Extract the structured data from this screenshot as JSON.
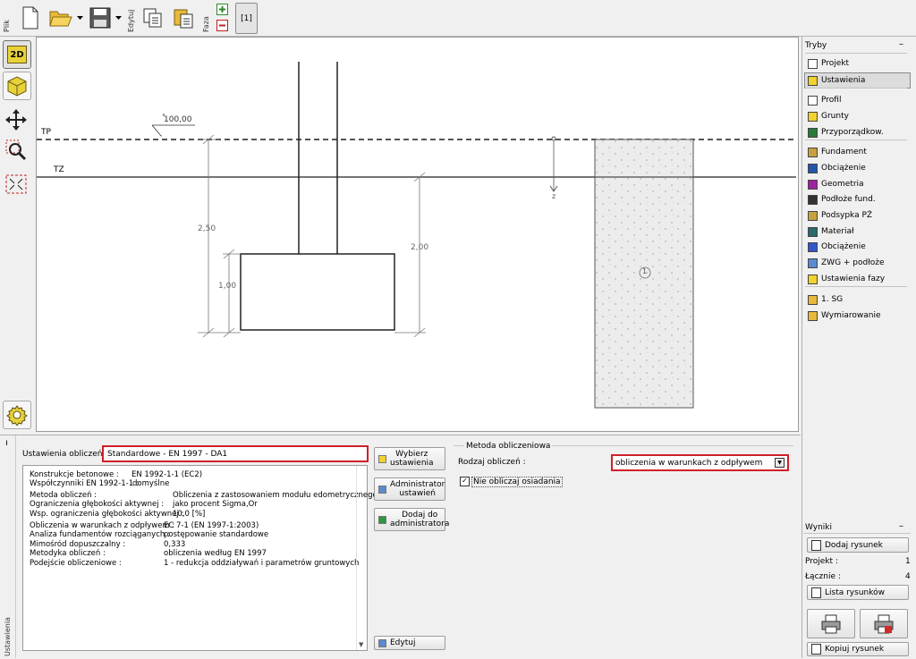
{
  "toolbar": {
    "file_group": "Plik",
    "edit_group": "Edytuj",
    "phase_group": "Faza",
    "phase_tab": "[1]"
  },
  "left_tools": {
    "btn_2d": "2D",
    "btn_3d": "3D"
  },
  "drawing": {
    "label_tp": "TP",
    "label_tz": "TZ",
    "dim_100": "100,00",
    "dim_250": "2,50",
    "dim_100b": "1,00",
    "dim_200": "2,00",
    "soil_number": "1",
    "axis_z": "z"
  },
  "right_panel": {
    "title": "Tryby",
    "items": [
      "Projekt",
      "Ustawienia",
      "Profil",
      "Grunty",
      "Przyporządkow.",
      "Fundament",
      "Obciążenie",
      "Geometria",
      "Podłoże fund.",
      "Podsypka PŻ",
      "Materiał",
      "Obciążenie",
      "ZWG + podłoże",
      "Ustawienia fazy",
      "1. SG",
      "Wymiarowanie"
    ],
    "results_title": "Wyniki",
    "add_drawing": "Dodaj rysunek",
    "project_label": "Projekt :",
    "project_value": "1",
    "total_label": "Łącznie :",
    "total_value": "4",
    "drawing_list": "Lista rysunków",
    "copy_drawing": "Kopiuj rysunek"
  },
  "bottom": {
    "side_tab": "Ustawienia",
    "settings_label": "Ustawienia obliczeń :",
    "settings_value": "Standardowe - EN 1997 - DA1",
    "info": [
      [
        "Konstrukcje betonowe :",
        "EN 1992-1-1 (EC2)"
      ],
      [
        "Współczynniki EN 1992-1-1 :",
        "domyślne"
      ],
      [
        "Metoda obliczeń :",
        "Obliczenia z zastosowaniem modułu edometrycznego"
      ],
      [
        "Ograniczenia głębokości aktywnej :",
        "jako procent Sigma,Or"
      ],
      [
        "Wsp. ograniczenia głębokości aktywnej :",
        "10,0 [%]"
      ],
      [
        "Obliczenia w warunkach z odpływem :",
        "EC 7-1 (EN 1997-1:2003)"
      ],
      [
        "Analiza fundamentów rozciąganych :",
        "postępowanie standardowe"
      ],
      [
        "Mimośród dopuszczalny :",
        "0,333"
      ],
      [
        "Metodyka obliczeń :",
        "obliczenia według EN 1997"
      ],
      [
        "Podejście obliczeniowe :",
        "1 - redukcja oddziaływań i parametrów gruntowych"
      ]
    ],
    "btn_select": [
      "Wybierz",
      "ustawienia"
    ],
    "btn_admin": [
      "Administrator",
      "ustawień"
    ],
    "btn_add": [
      "Dodaj do",
      "administratora"
    ],
    "btn_edit": "Edytuj",
    "method_title": "Metoda obliczeniowa",
    "calc_type_label": "Rodzaj obliczeń :",
    "calc_type_value": "obliczenia w warunkach z odpływem",
    "no_settlement": "Nie obliczaj osiadania"
  },
  "colors": {
    "highlight_red": "#d0202a",
    "tp_dash": "#555555",
    "accent_yellow": "#f2d22e"
  }
}
